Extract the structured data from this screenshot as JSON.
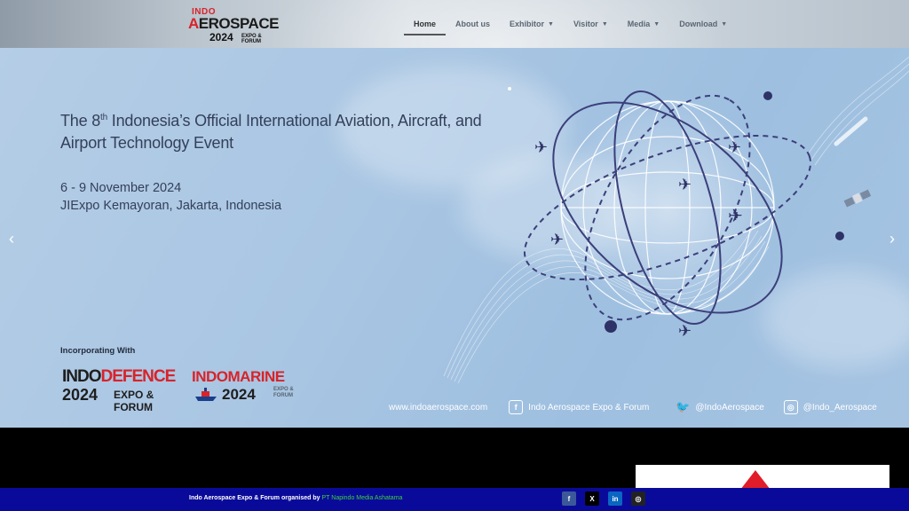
{
  "logo": {
    "line1": "INDO",
    "line2a": "A",
    "line2b": "ER",
    "line2c": "OSPACE",
    "year": "2024",
    "sub": "EXPO & FORUM"
  },
  "nav": {
    "items": [
      {
        "label": "Home",
        "active": true
      },
      {
        "label": "About us"
      },
      {
        "label": "Exhibitor",
        "dropdown": true
      },
      {
        "label": "Visitor",
        "dropdown": true
      },
      {
        "label": "Media",
        "dropdown": true
      },
      {
        "label": "Download",
        "dropdown": true
      }
    ]
  },
  "hero": {
    "title_pre": "The 8",
    "title_sup": "th",
    "title_post": " Indonesia’s Official International Aviation, Aircraft, and Airport Technology Event",
    "date": "6 - 9 November 2024",
    "venue": "JIExpo Kemayoran, Jakarta, Indonesia",
    "incorporating": "Incorporating With",
    "indodefence": {
      "a": "INDO",
      "b": "DEFENCE",
      "year": "2024",
      "sub": "EXPO & FORUM"
    },
    "indomarine": {
      "name": "INDOMARINE",
      "year": "2024",
      "sub": "EXPO & FORUM"
    },
    "strip": {
      "website": "www.indoaerospace.com",
      "facebook": "Indo Aerospace Expo & Forum",
      "twitter": "@IndoAerospace",
      "instagram": "@Indo_Aerospace"
    },
    "prev_arrow": "‹",
    "next_arrow": "›"
  },
  "footer": {
    "text": "Indo Aerospace Expo & Forum organised by ",
    "link": "PT Napindo Media Ashatama",
    "socials": [
      {
        "name": "facebook",
        "glyph": "f",
        "color": "#3b5998"
      },
      {
        "name": "x",
        "glyph": "X",
        "color": "#000000"
      },
      {
        "name": "linkedin",
        "glyph": "in",
        "color": "#0a66c2"
      },
      {
        "name": "instagram",
        "glyph": "◎",
        "color": "#222222"
      }
    ]
  },
  "colors": {
    "accent_red": "#d8232a",
    "footer_bg": "#0a0a9a",
    "footer_link": "#3dd13d",
    "hero_text": "#34405a"
  }
}
